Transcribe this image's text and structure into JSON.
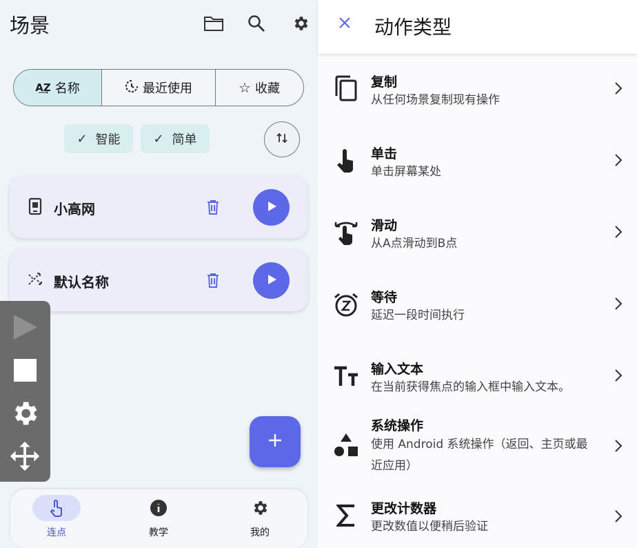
{
  "left": {
    "title": "场景",
    "icons": [
      "folder-icon",
      "search-icon",
      "gear-icon"
    ],
    "segments": [
      {
        "label": "名称",
        "icon": "sort-az-icon",
        "selected": true
      },
      {
        "label": "最近使用",
        "icon": "history-icon",
        "selected": false
      },
      {
        "label": "收藏",
        "icon": "star-icon",
        "selected": false
      }
    ],
    "chips": [
      {
        "label": "智能",
        "check": "✓"
      },
      {
        "label": "简单",
        "check": "✓"
      }
    ],
    "scenarios": [
      {
        "name": "小高网",
        "icon": "phone-icon"
      },
      {
        "name": "默认名称",
        "icon": "shuffle-icon"
      }
    ],
    "nav": [
      {
        "label": "连点",
        "icon": "tap-icon",
        "selected": true
      },
      {
        "label": "教学",
        "icon": "info-icon",
        "selected": false
      },
      {
        "label": "我的",
        "icon": "gear-icon",
        "selected": false
      }
    ],
    "fab_icon": "plus-icon"
  },
  "right": {
    "title": "动作类型",
    "close_icon": "close-icon",
    "actions": [
      {
        "title": "复制",
        "desc": "从任何场景复制现有操作",
        "icon": "copy-icon"
      },
      {
        "title": "单击",
        "desc": "单击屏幕某处",
        "icon": "tap-icon"
      },
      {
        "title": "滑动",
        "desc": "从A点滑动到B点",
        "icon": "swipe-icon"
      },
      {
        "title": "等待",
        "desc": "延迟一段时间执行",
        "icon": "alarm-icon"
      },
      {
        "title": "输入文本",
        "desc": "在当前获得焦点的输入框中输入文本。",
        "icon": "text-icon"
      },
      {
        "title": "系统操作",
        "desc": "使用 Android 系统操作（返回、主页或最近应用）",
        "icon": "shapes-icon"
      },
      {
        "title": "更改计数器",
        "desc": "更改数值以便稍后验证",
        "icon": "sigma-icon"
      }
    ]
  },
  "colors": {
    "accent": "#5d68e8",
    "chip": "#d8eeef",
    "card": "#ecedf8"
  }
}
